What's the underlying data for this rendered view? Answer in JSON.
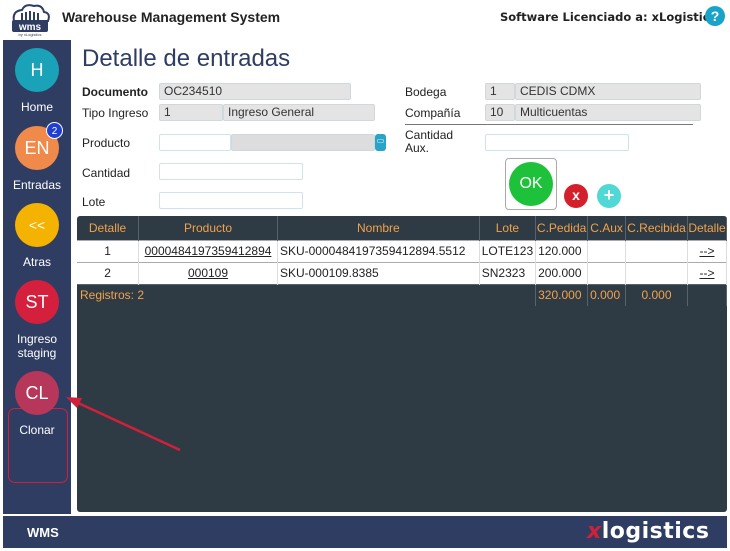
{
  "header": {
    "logo_text": "wms",
    "logo_sub": "by xLogistics",
    "app_title": "Warehouse Management System",
    "license": "Software Licenciado a: xLogistics",
    "help_icon": "?"
  },
  "sidebar": {
    "items": [
      {
        "initials": "H",
        "label": "Home",
        "color": "#1aa3b8"
      },
      {
        "initials": "EN",
        "label": "Entradas",
        "color": "#f08a4b",
        "badge": "2"
      },
      {
        "initials": "<<",
        "label": "Atras",
        "color": "#f5b301"
      },
      {
        "initials": "ST",
        "label": "Ingreso staging",
        "color": "#d4203d"
      },
      {
        "initials": "CL",
        "label": "Clonar",
        "color": "#b7375a"
      }
    ]
  },
  "page": {
    "title": "Detalle de entradas",
    "documento_label": "Documento",
    "documento_value": "OC234510",
    "tipo_label": "Tipo Ingreso",
    "tipo_code": "1",
    "tipo_name": "Ingreso General",
    "bodega_label": "Bodega",
    "bodega_code": "1",
    "bodega_name": "CEDIS CDMX",
    "compania_label": "Compañía",
    "compania_code": "10",
    "compania_name": "Multicuentas",
    "producto_label": "Producto",
    "cantidad_aux_label": "Cantidad Aux.",
    "cantidad_label": "Cantidad",
    "lote_label": "Lote",
    "ok_label": "OK",
    "cancel_label": "x",
    "add_label": "+"
  },
  "grid": {
    "columns": [
      "Detalle",
      "Producto",
      "Nombre",
      "Lote",
      "C.Pedida",
      "C.Aux",
      "C.Recibida",
      "Detalle"
    ],
    "rows": [
      {
        "detalle": "1",
        "producto": "0000484197359412894",
        "nombre": "SKU-0000484197359412894.5512",
        "lote": "LOTE123",
        "pedida": "120.000",
        "aux": "",
        "recibida": "",
        "link": "-->"
      },
      {
        "detalle": "2",
        "producto": "000109",
        "nombre": "SKU-000109.8385",
        "lote": "SN2323",
        "pedida": "200.000",
        "aux": "",
        "recibida": "",
        "link": "-->"
      }
    ],
    "total_label": "Registros: 2",
    "total_pedida": "320.000",
    "total_aux": "0.000",
    "total_recibida": "0.000"
  },
  "footer": {
    "label": "WMS",
    "brand_x": "x",
    "brand_rest": "logistics"
  }
}
